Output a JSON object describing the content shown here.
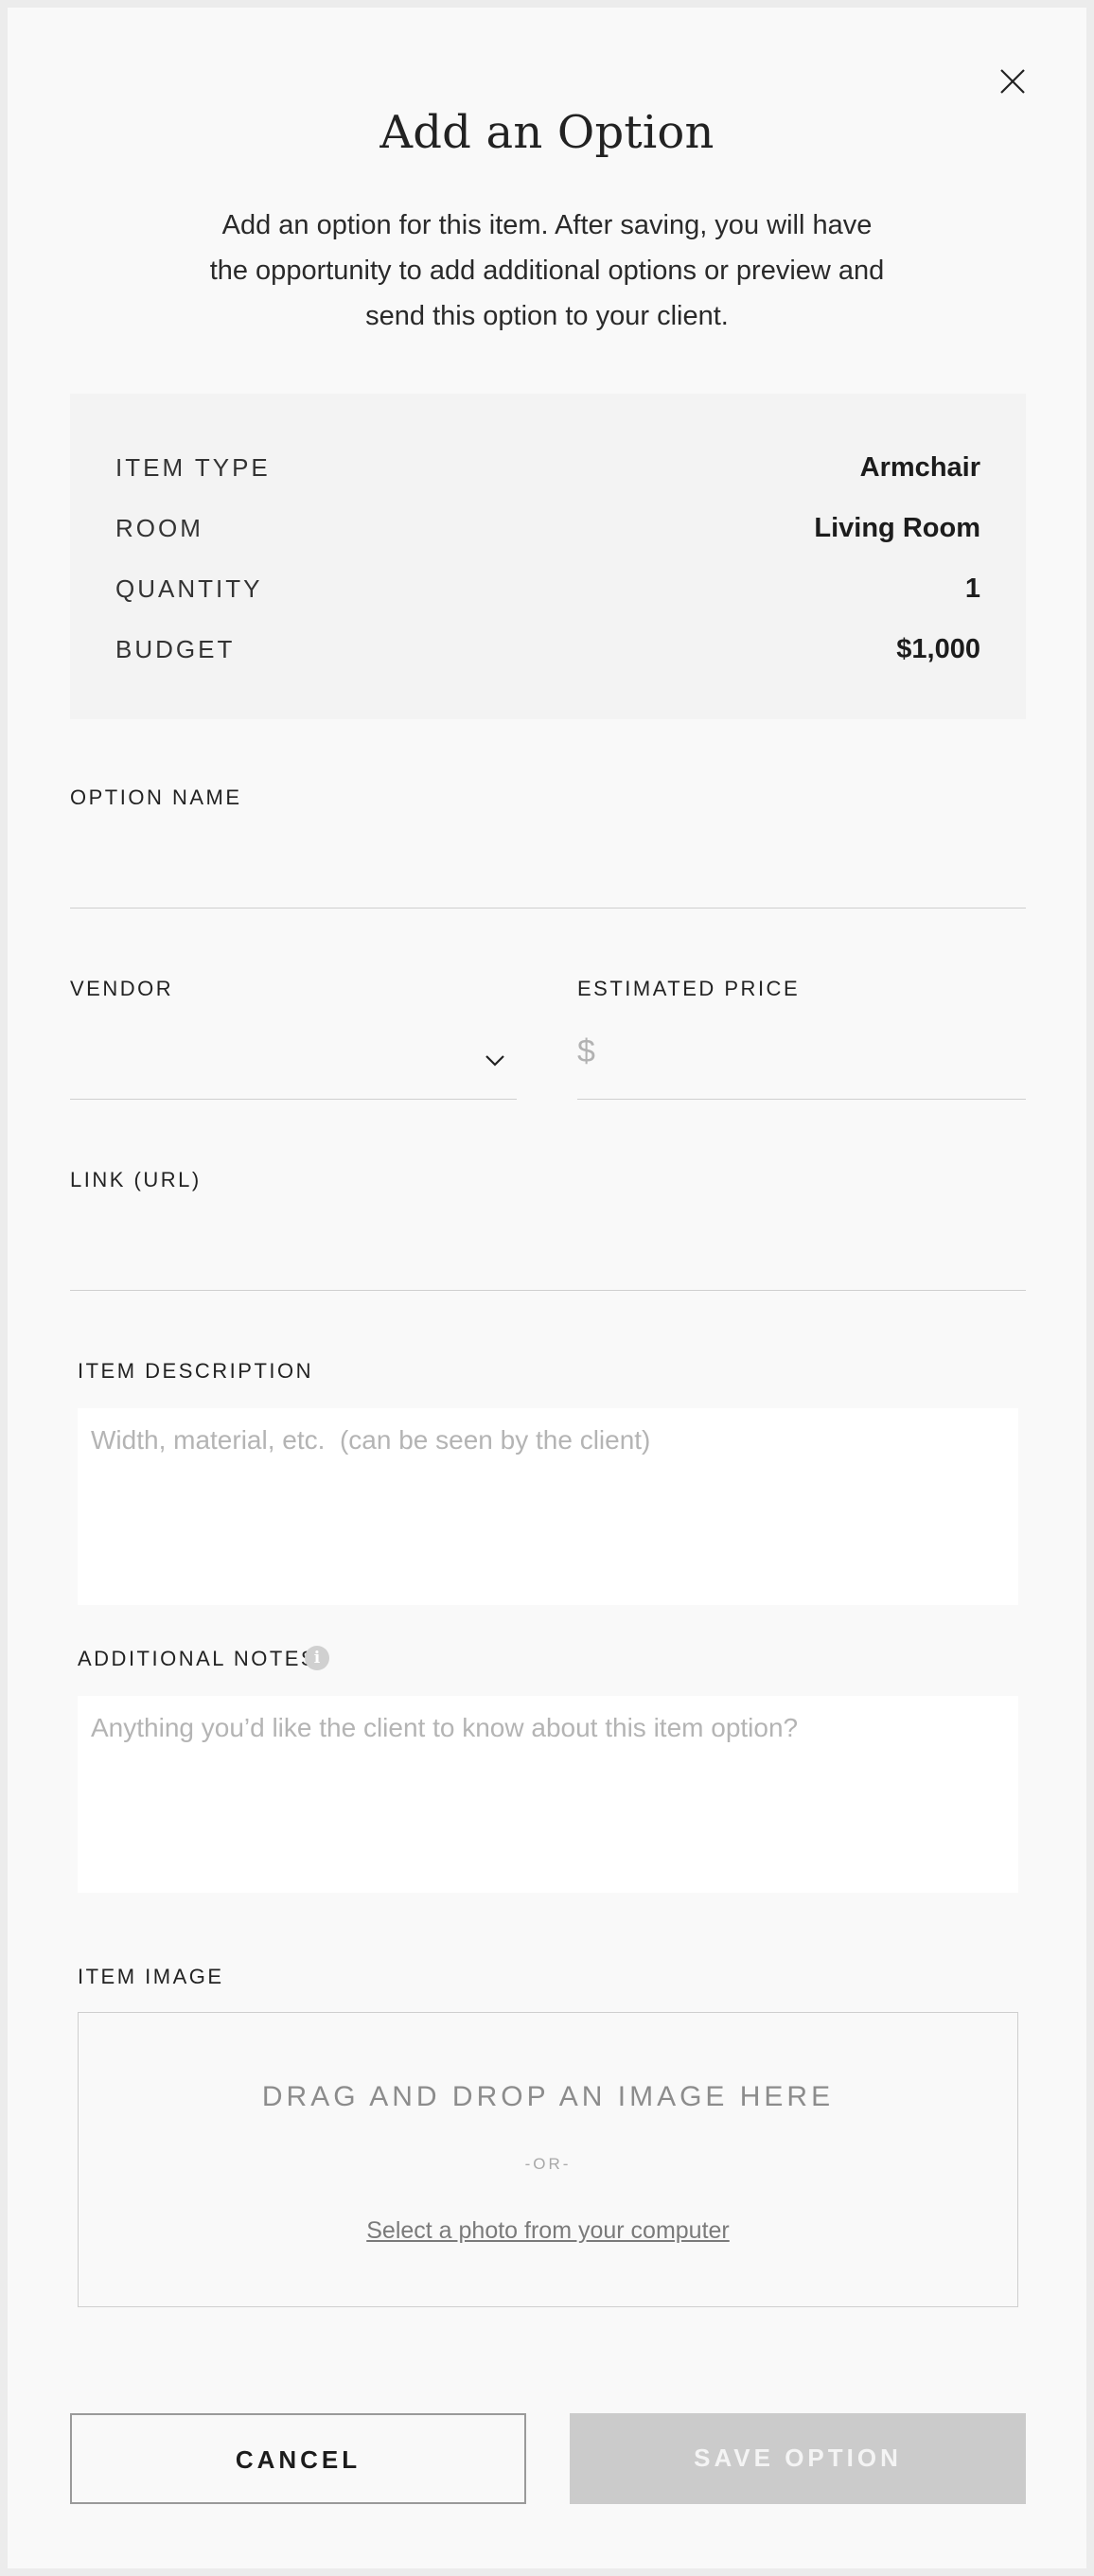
{
  "modal": {
    "title": "Add an Option",
    "subtitle": "Add an option for this item. After saving, you will have the opportunity to add additional options or preview and send this option to your client.",
    "close_icon": "close-icon"
  },
  "summary": {
    "rows": [
      {
        "label": "ITEM TYPE",
        "value": "Armchair"
      },
      {
        "label": "ROOM",
        "value": "Living Room"
      },
      {
        "label": "QUANTITY",
        "value": "1"
      },
      {
        "label": "BUDGET",
        "value": "$1,000"
      }
    ]
  },
  "form": {
    "option_name": {
      "label": "OPTION NAME",
      "value": ""
    },
    "vendor": {
      "label": "VENDOR",
      "value": "",
      "icon": "chevron-down-icon"
    },
    "estimated_price": {
      "label": "ESTIMATED PRICE",
      "prefix": "$",
      "value": ""
    },
    "link": {
      "label": "LINK (URL)",
      "value": ""
    },
    "item_description": {
      "label": "ITEM DESCRIPTION",
      "placeholder": "Width, material, etc.  (can be seen by the client)"
    },
    "additional_notes": {
      "label": "ADDITIONAL NOTES",
      "info_icon_glyph": "i",
      "placeholder": "Anything you’d like the client to know about this item option?"
    },
    "item_image": {
      "label": "ITEM IMAGE",
      "drop_text": "DRAG AND DROP AN IMAGE HERE",
      "or_text": "-OR-",
      "select_link": "Select a photo from your computer"
    }
  },
  "buttons": {
    "cancel": "CANCEL",
    "save": "SAVE OPTION"
  },
  "colors": {
    "background": "#f9f9f9",
    "summary_bg": "#f3f3f3",
    "save_disabled": "#cbcbcb",
    "text": "#1c1c1c"
  }
}
